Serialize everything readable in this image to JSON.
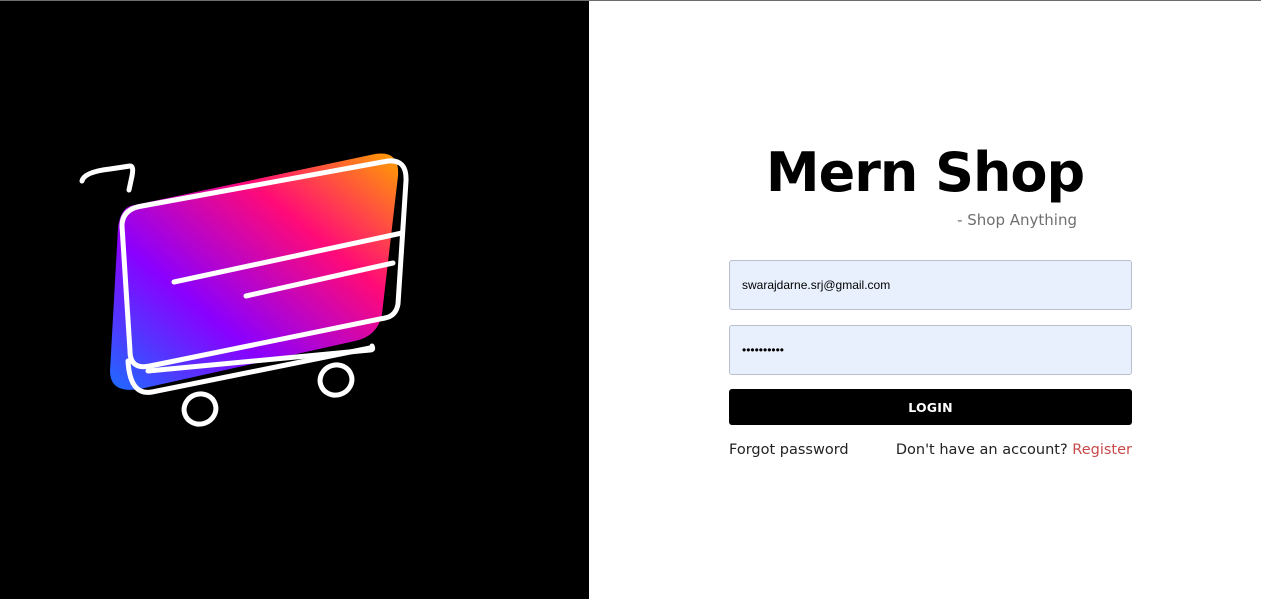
{
  "brand": {
    "title": "Mern Shop",
    "tagline": "- Shop Anything"
  },
  "hero": {
    "icon": "shopping-cart-icon",
    "gradient_colors": [
      "#1e6bff",
      "#8a00ff",
      "#ff0a78",
      "#ffa000"
    ],
    "background": "#000000"
  },
  "login_form": {
    "email_value": "swarajdarne.srj@gmail.com",
    "password_value": "••••••••••",
    "login_label": "LOGIN",
    "forgot_label": "Forgot password",
    "no_account_text": "Don't have an account? ",
    "register_label": "Register",
    "register_color": "#c94a4a",
    "field_background": "#e8f0fe"
  }
}
